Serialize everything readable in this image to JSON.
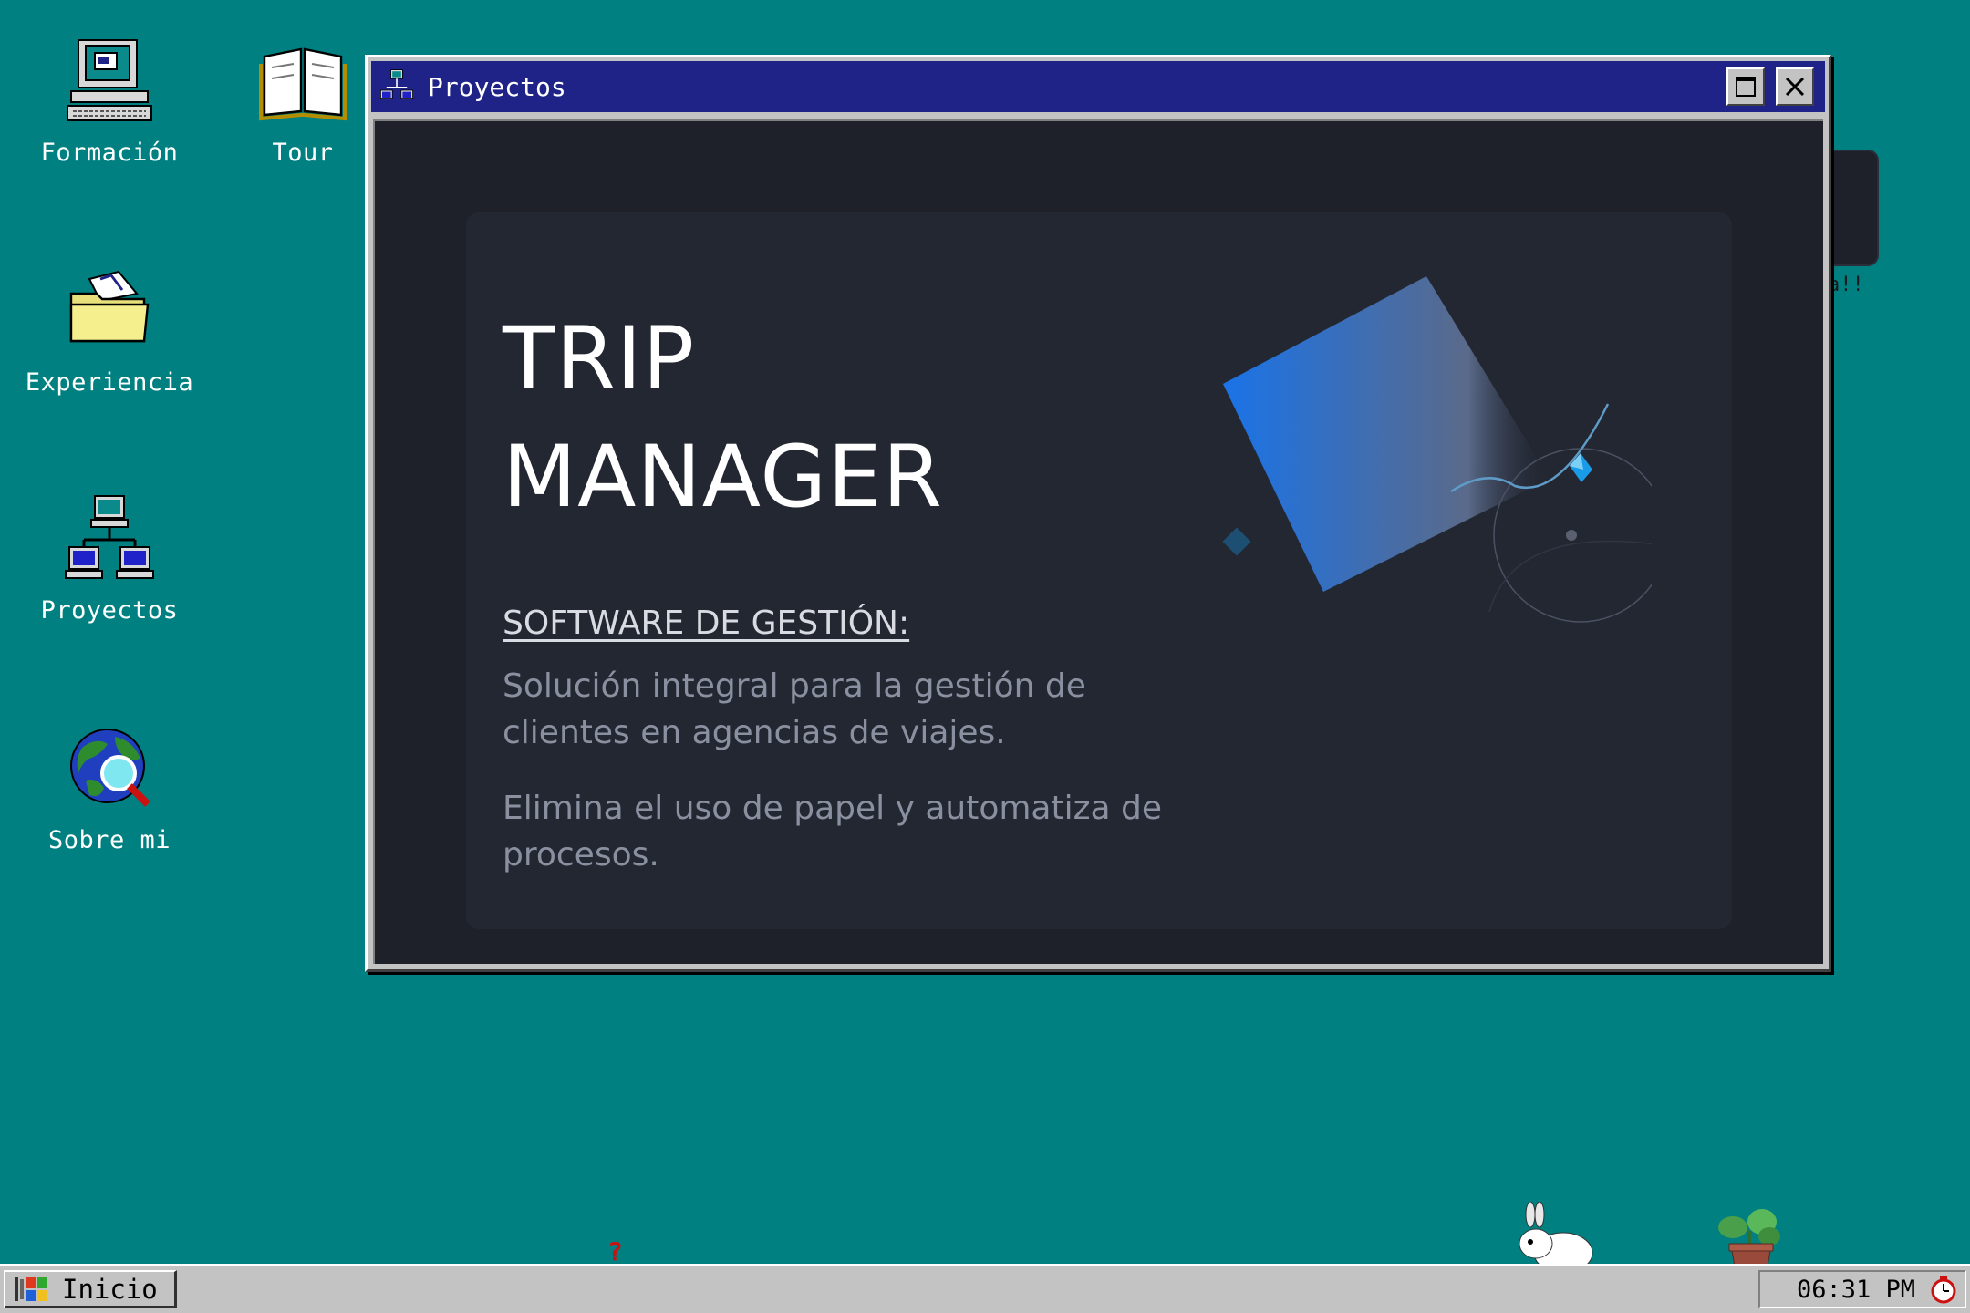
{
  "desktop": {
    "icons": [
      {
        "label": "Formación",
        "icon": "computer-icon"
      },
      {
        "label": "Tour",
        "icon": "book-icon"
      },
      {
        "label": "Experiencia",
        "icon": "folder-icon"
      },
      {
        "label": "Proyectos",
        "icon": "network-icon"
      },
      {
        "label": "Sobre mi",
        "icon": "globe-search-icon"
      }
    ],
    "partial_window_label": "a!!"
  },
  "window": {
    "title": "Proyectos",
    "icon": "network-icon",
    "maximize_icon": "maximize-icon",
    "close_icon": "close-icon",
    "content": {
      "title_line1": "TRIP",
      "title_line2": "MANAGER",
      "subtitle": "SOFTWARE DE GESTIÓN:",
      "paragraph1": "Solución integral para la gestión de clientes en agencias de viajes.",
      "paragraph2": "Elimina el uso de papel y automatiza de procesos."
    }
  },
  "taskbar": {
    "start_label": "Inicio",
    "start_icon": "windows-logo-icon",
    "clock": "06:31 PM",
    "tray_icon": "timer-icon"
  },
  "colors": {
    "desktop": "#008081",
    "titlebar": "#1f2286",
    "window_bg": "#1e2129",
    "card_bg": "#232732",
    "accent": "#1a73e8"
  }
}
